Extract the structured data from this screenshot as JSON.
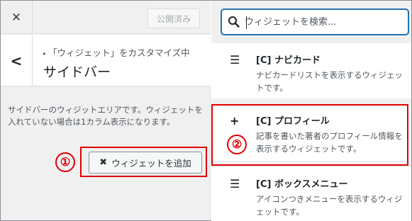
{
  "topbar": {
    "close_icon": "close-icon",
    "published_label": "公開済み"
  },
  "header": {
    "back_icon": "chevron-left-icon",
    "breadcrumb": "「ウィジェット」をカスタマイズ中",
    "title": "サイドバー"
  },
  "sidebar": {
    "description": "サイドバーのウィジットエリアです。ウィジェットを入れていない場合は1カラム表示になります。",
    "add_button_label": "ウィジェットを追加",
    "marker": "①"
  },
  "search": {
    "placeholder": "ウィジェットを検索...",
    "value": ""
  },
  "widgets": [
    {
      "icon": "menu-icon",
      "title": "[C] ナビカード",
      "description": "ナビカードリストを表示するウィジェットです。"
    },
    {
      "icon": "plus-icon",
      "title": "[C] プロフィール",
      "description": "記事を書いた著者のプロフィール情報を表示するウィジェットです。"
    },
    {
      "icon": "menu-icon",
      "title": "[C] ボックスメニュー",
      "description": "アイコンつきメニューを表示するウィジェットです。"
    }
  ],
  "annotations": {
    "marker_2": "②",
    "highlight_color": "#e00000"
  }
}
